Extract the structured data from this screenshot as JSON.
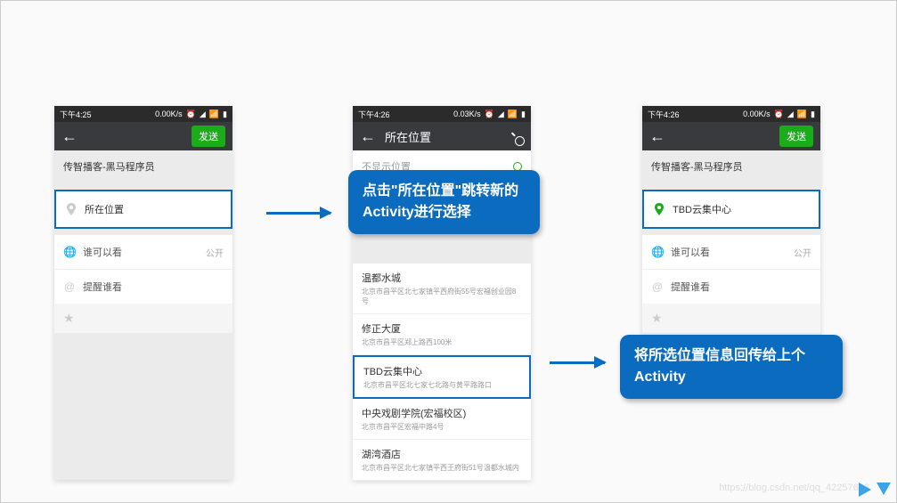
{
  "phone1": {
    "status": {
      "time": "下午4:25",
      "speed": "0.00K/s"
    },
    "nav": {
      "send": "发送"
    },
    "user": "传智播客-黑马程序员",
    "location": "所在位置",
    "options": {
      "visibility": {
        "label": "谁可以看",
        "value": "公开"
      },
      "remind": {
        "label": "提醒谁看"
      }
    }
  },
  "phone2": {
    "status": {
      "time": "下午4:26",
      "speed": "0.03K/s"
    },
    "nav": {
      "title": "所在位置"
    },
    "no_show": "不显示位置",
    "locations": [
      {
        "name": "温都水城",
        "addr": "北京市昌平区北七家镇平西府街55号宏福创业园8号"
      },
      {
        "name": "修正大厦",
        "addr": "北京市昌平区郑上路西100米"
      },
      {
        "name": "TBD云集中心",
        "addr": "北京市昌平区北七家七北路与黄平路路口"
      },
      {
        "name": "中央戏剧学院(宏福校区)",
        "addr": "北京市昌平区宏福中路4号"
      },
      {
        "name": "湖湾酒店",
        "addr": "北京市昌平区北七家镇平西王府街51号温都水城内"
      }
    ]
  },
  "phone3": {
    "status": {
      "time": "下午4:26",
      "speed": "0.00K/s"
    },
    "nav": {
      "send": "发送"
    },
    "user": "传智播客-黑马程序员",
    "location": "TBD云集中心",
    "options": {
      "visibility": {
        "label": "谁可以看",
        "value": "公开"
      },
      "remind": {
        "label": "提醒谁看"
      }
    }
  },
  "callouts": {
    "c1": "点击\"所在位置\"跳转新的Activity进行选择",
    "c2": "将所选位置信息回传给上个Activity"
  },
  "watermark": "https://blog.csdn.net/qq_42257666"
}
